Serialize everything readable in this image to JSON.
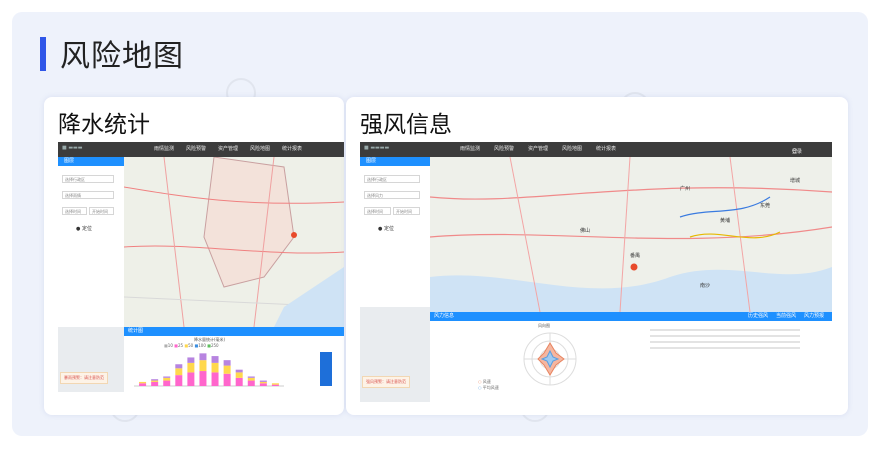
{
  "page": {
    "title": "风险地图"
  },
  "left_card": {
    "title": "降水统计",
    "nav_items": [
      "雨情监测",
      "风险预警",
      "资产管理",
      "风险地图",
      "统计报表"
    ],
    "panel_label": "图层",
    "fields": [
      "选择行政区",
      "选择雨情",
      "选择时间",
      "开始时间"
    ],
    "location_btn": "定位",
    "chart_panel_title": "统计图",
    "chart_title": "降水量统计(毫米)",
    "legend": [
      "10",
      "25",
      "50",
      "100",
      "250"
    ],
    "warning": "暴雨预警：请注意防范"
  },
  "right_card": {
    "title": "强风信息",
    "nav_items": [
      "雨情监测",
      "风险预警",
      "资产管理",
      "风险地图",
      "统计报表"
    ],
    "user": "登录",
    "panel_label": "图层",
    "fields": [
      "选择行政区",
      "选择风力",
      "选择时间",
      "开始时间"
    ],
    "location_btn": "定位",
    "bar_left": "风力信息",
    "bar_right": [
      "历史强风",
      "当前强风",
      "风力预报"
    ],
    "rose_title": "风向图",
    "rose_legend": [
      "风速",
      "平均风速"
    ],
    "warning": "强风预警：请注意防范",
    "map_places": [
      "广州",
      "东莞",
      "佛山",
      "南沙",
      "番禺",
      "增城",
      "黄埔"
    ]
  },
  "chart_data": {
    "type": "bar",
    "categories": [
      "1",
      "2",
      "3",
      "4",
      "5",
      "6",
      "7",
      "8",
      "9",
      "10",
      "11",
      "12"
    ],
    "series": [
      {
        "name": "10",
        "values": [
          2,
          3,
          4,
          8,
          10,
          11,
          10,
          9,
          6,
          4,
          2,
          1
        ]
      },
      {
        "name": "25",
        "values": [
          1,
          1,
          2,
          5,
          7,
          8,
          7,
          6,
          4,
          2,
          1,
          1
        ]
      },
      {
        "name": "50",
        "values": [
          0,
          1,
          1,
          3,
          4,
          5,
          5,
          4,
          2,
          1,
          1,
          0
        ]
      }
    ]
  },
  "colors": {
    "accent": "#2f56e8",
    "nav": "#3c3c3c",
    "blue": "#1e90ff",
    "warn_text": "#d9534f"
  }
}
